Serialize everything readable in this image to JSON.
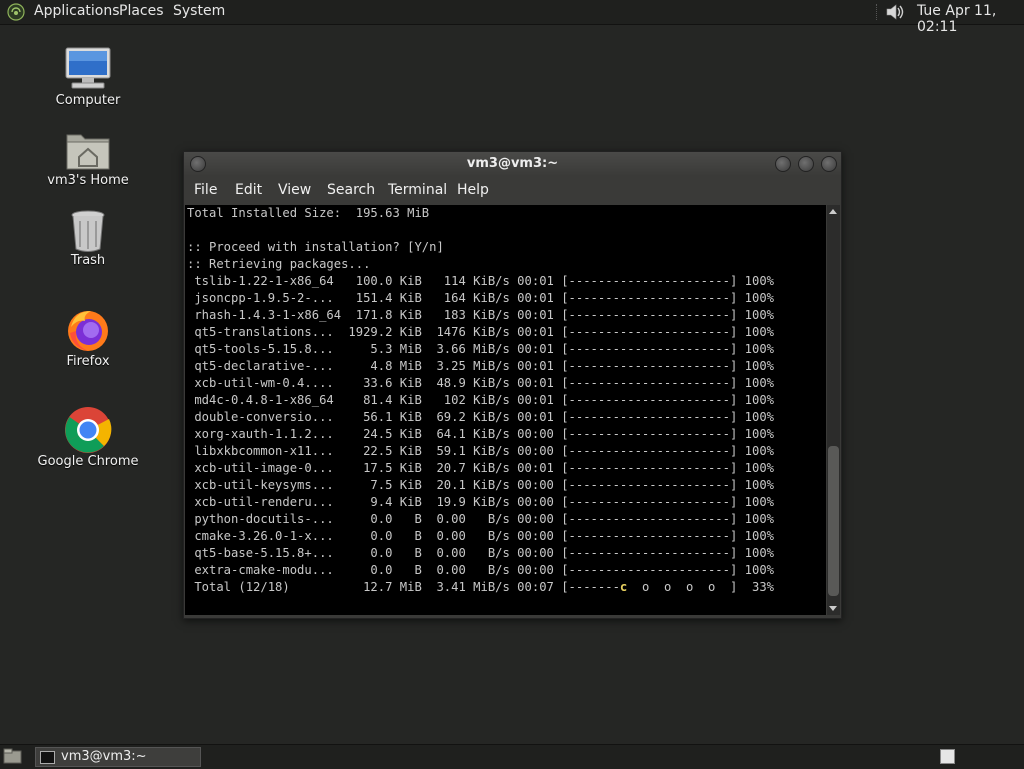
{
  "top_panel": {
    "menus": [
      "Applications",
      "Places",
      "System"
    ],
    "clock": "Tue Apr 11, 02:11",
    "volume_icon": "speaker-icon"
  },
  "desktop_icons": [
    {
      "label": "Computer",
      "icon": "computer-icon"
    },
    {
      "label": "vm3's Home",
      "icon": "home-folder-icon"
    },
    {
      "label": "Trash",
      "icon": "trash-icon"
    },
    {
      "label": "Firefox",
      "icon": "firefox-icon"
    },
    {
      "label": "Google Chrome",
      "icon": "chrome-icon"
    }
  ],
  "terminal": {
    "title": "vm3@vm3:~",
    "menu": [
      "File",
      "Edit",
      "View",
      "Search",
      "Terminal",
      "Help"
    ],
    "lines": [
      "Total Installed Size:  195.63 MiB",
      "",
      ":: Proceed with installation? [Y/n]",
      ":: Retrieving packages...",
      " tslib-1.22-1-x86_64   100.0 KiB   114 KiB/s 00:01 [----------------------] 100%",
      " jsoncpp-1.9.5-2-...   151.4 KiB   164 KiB/s 00:01 [----------------------] 100%",
      " rhash-1.4.3-1-x86_64  171.8 KiB   183 KiB/s 00:01 [----------------------] 100%",
      " qt5-translations...  1929.2 KiB  1476 KiB/s 00:01 [----------------------] 100%",
      " qt5-tools-5.15.8...     5.3 MiB  3.66 MiB/s 00:01 [----------------------] 100%",
      " qt5-declarative-...     4.8 MiB  3.25 MiB/s 00:01 [----------------------] 100%",
      " xcb-util-wm-0.4....    33.6 KiB  48.9 KiB/s 00:01 [----------------------] 100%",
      " md4c-0.4.8-1-x86_64    81.4 KiB   102 KiB/s 00:01 [----------------------] 100%",
      " double-conversio...    56.1 KiB  69.2 KiB/s 00:01 [----------------------] 100%",
      " xorg-xauth-1.1.2...    24.5 KiB  64.1 KiB/s 00:00 [----------------------] 100%",
      " libxkbcommon-x11...    22.5 KiB  59.1 KiB/s 00:00 [----------------------] 100%",
      " xcb-util-image-0...    17.5 KiB  20.7 KiB/s 00:01 [----------------------] 100%",
      " xcb-util-keysyms...     7.5 KiB  20.1 KiB/s 00:00 [----------------------] 100%",
      " xcb-util-renderu...     9.4 KiB  19.9 KiB/s 00:00 [----------------------] 100%",
      " python-docutils-...     0.0   B  0.00   B/s 00:00 [----------------------] 100%",
      " cmake-3.26.0-1-x...     0.0   B  0.00   B/s 00:00 [----------------------] 100%",
      " qt5-base-5.15.8+...     0.0   B  0.00   B/s 00:00 [----------------------] 100%",
      " extra-cmake-modu...     0.0   B  0.00   B/s 00:00 [----------------------] 100%"
    ],
    "total_line": {
      "prefix": " Total (12/18)          12.7 MiB  3.41 MiB/s 00:07 [-------",
      "cursor": "c",
      "suffix": "  o  o  o  o  ]  33%"
    }
  },
  "taskbar": {
    "tasks": [
      {
        "label": "vm3@vm3:~",
        "icon": "terminal-icon"
      }
    ],
    "show_desktop_icon": "show-desktop-icon",
    "workspace_icon": "workspace-switcher-icon"
  }
}
